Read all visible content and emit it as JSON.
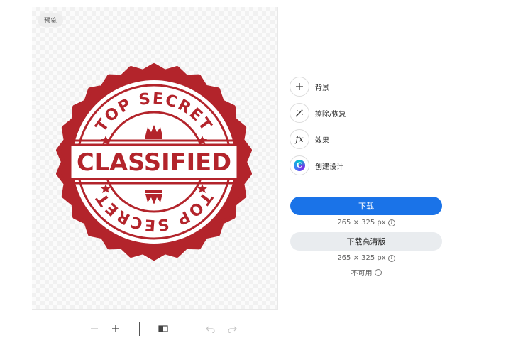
{
  "preview": {
    "tag": "预览",
    "stamp": {
      "top_text": "TOP SECRET",
      "center_text": "CLASSIFIED",
      "bottom_text": "TOP SECRET",
      "color": "#b3242b"
    }
  },
  "toolbar": {
    "zoom_out_icon": "minus-icon",
    "zoom_in_icon": "plus-icon",
    "compare_icon": "compare-icon",
    "undo_icon": "undo-icon",
    "redo_icon": "redo-icon"
  },
  "tools": [
    {
      "icon": "plus-icon",
      "label": "背景"
    },
    {
      "icon": "eraser-wand-icon",
      "label": "擦除/恢复"
    },
    {
      "icon": "fx-icon",
      "label": "效果"
    },
    {
      "icon": "canva-logo-icon",
      "label": "创建设计"
    }
  ],
  "download": {
    "label": "下载",
    "size": "265 × 325 px",
    "color": "#1a73e8"
  },
  "download_hd": {
    "label": "下载高清版",
    "size": "265 × 325 px",
    "status": "不可用"
  }
}
